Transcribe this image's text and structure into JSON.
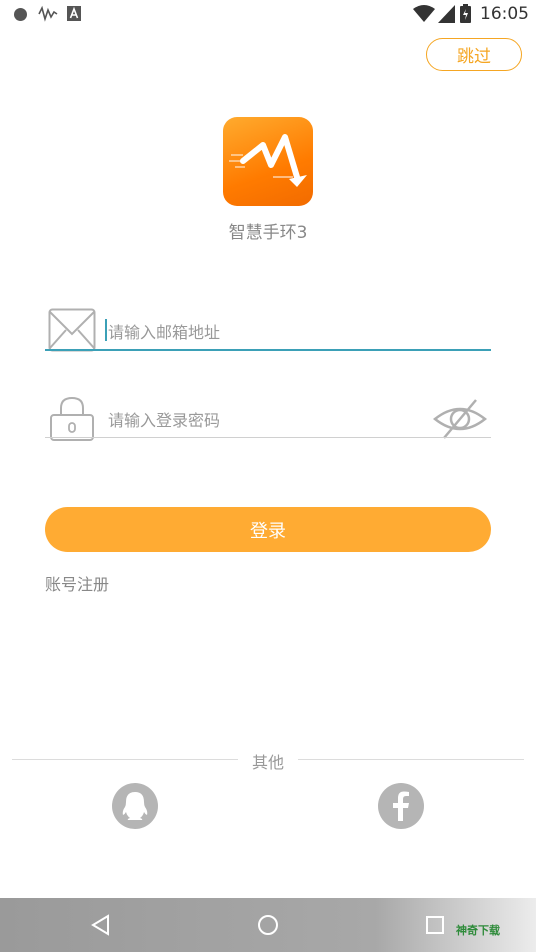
{
  "status_bar": {
    "time": "16:05",
    "notif_icons": [
      "circle-dot-icon",
      "signal-wave-icon",
      "a-letter-icon"
    ],
    "status_icons": [
      "wifi-icon",
      "cell-signal-icon",
      "battery-icon"
    ]
  },
  "skip_label": "跳过",
  "app": {
    "name": "智慧手环3",
    "logo_icon": "app-logo-icon"
  },
  "login": {
    "email_placeholder": "请输入邮箱地址",
    "password_placeholder": "请输入登录密码",
    "button_label": "登录",
    "register_label": "账号注册"
  },
  "other": {
    "label": "其他",
    "social": [
      "qq-icon",
      "facebook-icon"
    ]
  },
  "nav": {
    "buttons": [
      "back-icon",
      "home-icon",
      "recents-icon"
    ],
    "watermark": "神奇下载"
  },
  "colors": {
    "accent": "#ffab33",
    "focus": "#3ba0b7",
    "logo": "#ff8a00"
  }
}
